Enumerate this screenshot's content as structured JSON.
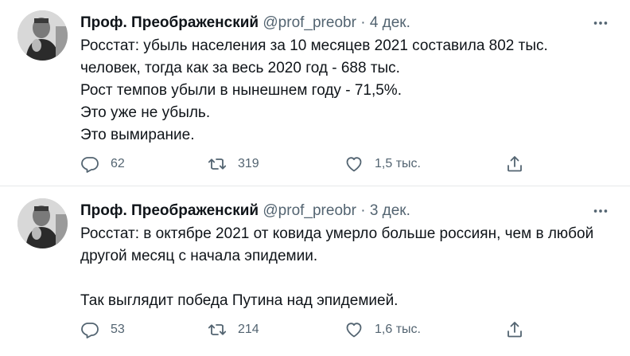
{
  "tweets": [
    {
      "author_name": "Проф. Преображенский",
      "handle": "@prof_preobr",
      "separator": "·",
      "date": "4 дек.",
      "lines": [
        "Росстат: убыль населения за 10 месяцев 2021 составила 802 тыс.",
        "человек, тогда как за весь 2020 год - 688 тыс.",
        "Рост темпов убыли в нынешнем году - 71,5%.",
        "Это уже не убыль.",
        "Это вымирание."
      ],
      "replies": "62",
      "retweets": "319",
      "likes": "1,5 тыс."
    },
    {
      "author_name": "Проф. Преображенский",
      "handle": "@prof_preobr",
      "separator": "·",
      "date": "3 дек.",
      "lines": [
        "Росстат: в октябре 2021 от ковида умерло больше россиян, чем в любой",
        "другой месяц с начала эпидемии.",
        "",
        "Так выглядит победа Путина над эпидемией."
      ],
      "replies": "53",
      "retweets": "214",
      "likes": "1,6 тыс."
    }
  ],
  "icons": {
    "more": "more-horizontal-icon",
    "reply": "reply-bubble-icon",
    "retweet": "retweet-icon",
    "like": "heart-icon",
    "share": "share-upload-icon"
  },
  "colors": {
    "text": "#0f1419",
    "secondary": "#536471",
    "divider": "#e7e9ea"
  }
}
